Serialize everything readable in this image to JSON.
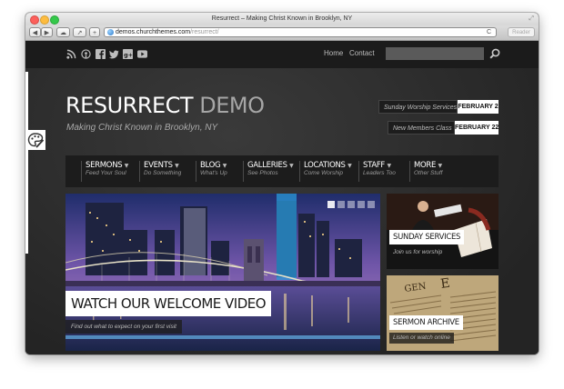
{
  "window": {
    "title": "Resurrect – Making Christ Known in Brooklyn, NY"
  },
  "toolbar": {
    "url_domain": "demos.churchthemes.com",
    "url_path": "/resurrect/",
    "reader_label": "Reader",
    "refresh_glyph": "C"
  },
  "header": {
    "social_icons": [
      "rss-icon",
      "podcast-icon",
      "facebook-icon",
      "twitter-icon",
      "google-plus-icon",
      "youtube-icon"
    ],
    "nav": [
      "Home",
      "Contact"
    ],
    "search_placeholder": ""
  },
  "logo": {
    "strong": "RESURRECT",
    "light": "DEMO",
    "tagline": "Making Christ Known in Brooklyn, NY"
  },
  "events": [
    {
      "name": "Sunday Worship Services",
      "date": "FEBRUARY 2"
    },
    {
      "name": "New Members Class",
      "date": "FEBRUARY 22"
    }
  ],
  "menu": [
    {
      "label": "SERMONS",
      "sub": "Feed Your Soul"
    },
    {
      "label": "EVENTS",
      "sub": "Do Something"
    },
    {
      "label": "BLOG",
      "sub": "What's Up"
    },
    {
      "label": "GALLERIES",
      "sub": "See Photos"
    },
    {
      "label": "LOCATIONS",
      "sub": "Come Worship"
    },
    {
      "label": "STAFF",
      "sub": "Leaders Too"
    },
    {
      "label": "MORE",
      "sub": "Other Stuff"
    }
  ],
  "slide": {
    "title": "WATCH OUR WELCOME VIDEO",
    "subtitle": "Find out what to expect on your first visit",
    "dots": 5,
    "active_dot": 1
  },
  "features": [
    {
      "title": "SUNDAY SERVICES",
      "subtitle": "Join us for worship"
    },
    {
      "title": "SERMON ARCHIVE",
      "subtitle": "Listen or watch online"
    }
  ],
  "colors": {
    "page_bg": "#2d2d2d",
    "topbar": "#1b1b1b",
    "accent_white": "#ffffff",
    "muted_text": "#a8a8a8"
  }
}
